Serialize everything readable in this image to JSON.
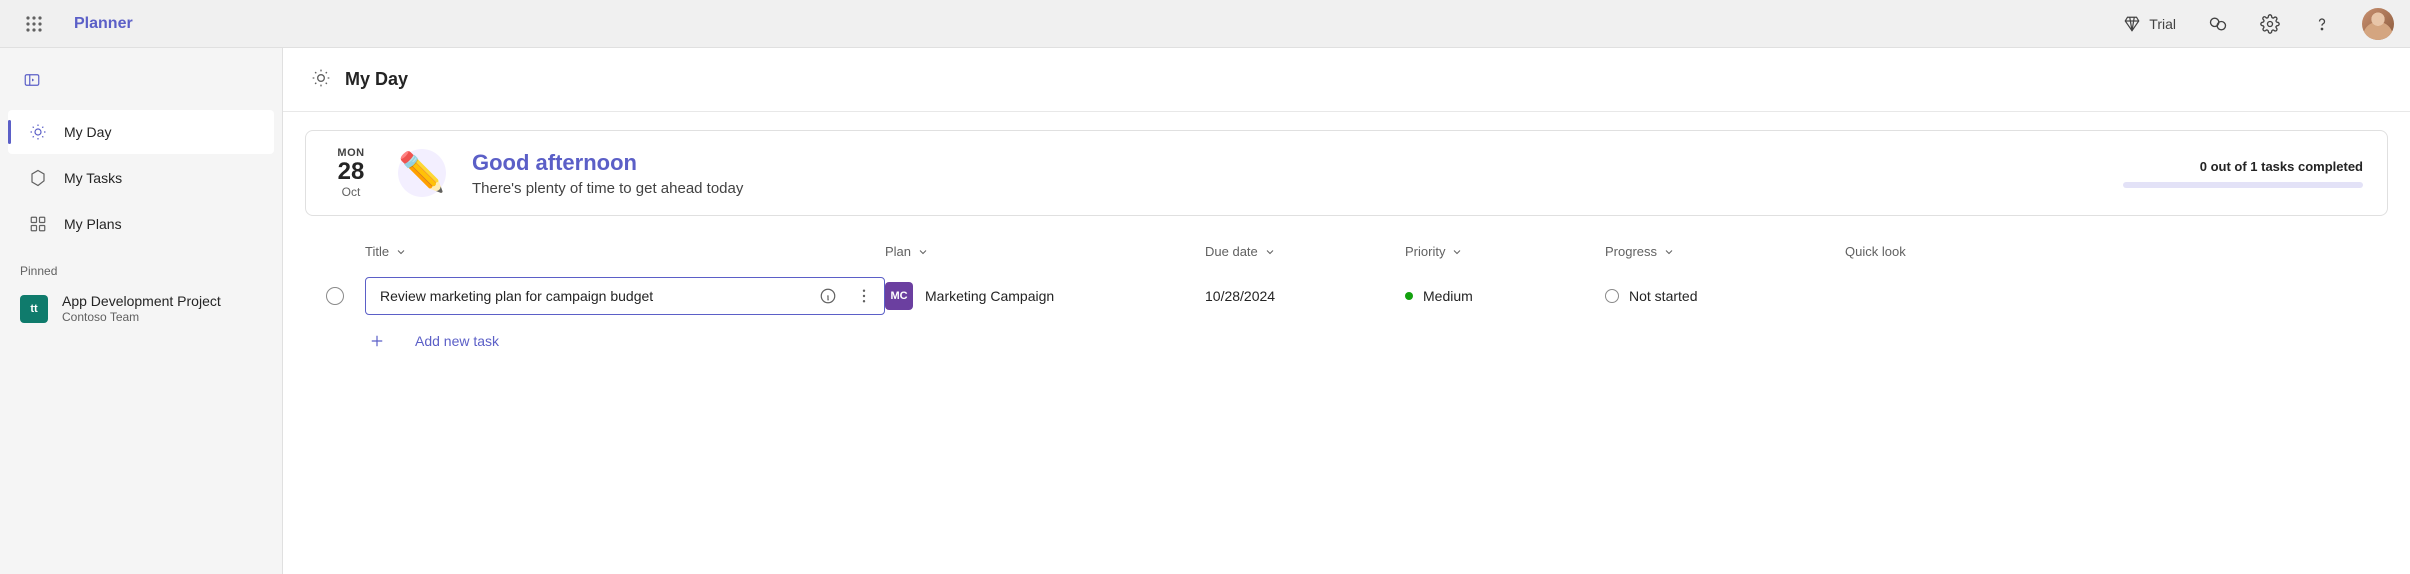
{
  "header": {
    "brand": "Planner",
    "trial_label": "Trial"
  },
  "sidebar": {
    "items": [
      {
        "label": "My Day"
      },
      {
        "label": "My Tasks"
      },
      {
        "label": "My Plans"
      }
    ],
    "pinned_label": "Pinned",
    "pinned": [
      {
        "badge": "tt",
        "title": "App Development Project",
        "subtitle": "Contoso Team"
      }
    ]
  },
  "page": {
    "title": "My Day"
  },
  "greeting": {
    "dow": "MON",
    "day": "28",
    "month": "Oct",
    "title": "Good afternoon",
    "subtitle": "There's plenty of time to get ahead today",
    "progress_label": "0 out of 1 tasks completed"
  },
  "columns": {
    "title": "Title",
    "plan": "Plan",
    "due": "Due date",
    "priority": "Priority",
    "progress": "Progress",
    "quick": "Quick look"
  },
  "tasks": [
    {
      "title": "Review marketing plan for campaign budget",
      "plan_badge": "MC",
      "plan_name": "Marketing Campaign",
      "due": "10/28/2024",
      "priority": "Medium",
      "progress": "Not started"
    }
  ],
  "add_task_label": "Add new task"
}
